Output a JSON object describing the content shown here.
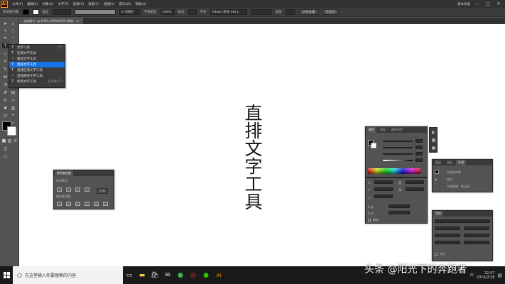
{
  "menubar": {
    "logo": "Ai",
    "items": [
      "文件(F)",
      "编辑(E)",
      "对象(O)",
      "文字(T)",
      "选择(S)",
      "效果(C)",
      "视图(V)",
      "窗口(W)",
      "帮助(H)"
    ],
    "workspace": "基本功能",
    "window_buttons": [
      "—",
      "□",
      "✕"
    ]
  },
  "controlbar": {
    "label_none_selected": "未选择对象",
    "stroke_label": "描边",
    "profile_value": "5 点圆形",
    "opacity_label": "不透明度",
    "opacity_value": "100%",
    "style_label": "样式",
    "char_label": "字符",
    "font_value": "Adobe 宋体 Std L",
    "para_label": "段落",
    "doc_setup": "文档设置",
    "preferences": "首选项",
    "fill_color": "#000000",
    "stroke_color": "#ffffff"
  },
  "tab": {
    "title": "未标题-1* @ 100% (CMYK/GPU 预览)",
    "close": "✕"
  },
  "flyout": {
    "items": [
      {
        "label": "文字工具",
        "key": "(T)",
        "icon": "T"
      },
      {
        "label": "区域文字工具",
        "key": "",
        "icon": "T"
      },
      {
        "label": "路径文字工具",
        "key": "",
        "icon": "~"
      },
      {
        "label": "直排文字工具",
        "key": "",
        "icon": "T"
      },
      {
        "label": "直排区域文字工具",
        "key": "",
        "icon": "T"
      },
      {
        "label": "直排路径文字工具",
        "key": "",
        "icon": "~"
      },
      {
        "label": "修饰文字工具",
        "key": "(Shift+T)",
        "icon": "T"
      }
    ],
    "highlighted_index": 3
  },
  "canvas": {
    "vertical_text": "直排文字工具"
  },
  "pathfinder_panel": {
    "title": "路径查找器",
    "shape_modes": "形状模式：",
    "expand": "扩展",
    "pathfinders": "路径查找器："
  },
  "color_panel": {
    "tabs": [
      "颜色",
      "色板",
      "颜色参考"
    ],
    "fill_color": "#000000",
    "stroke_color": "#ffffff"
  },
  "transform_panel": {
    "fields": [
      "X:",
      "Y:",
      "宽:",
      "高:"
    ],
    "angle_label": "△:",
    "value_a": "0 pt",
    "value_b": "0 pt",
    "align_label": "对齐像素网格",
    "checkbox_label": "缩放"
  },
  "layers_panel": {
    "tabs": [
      "图层",
      "画板",
      "外观"
    ],
    "row1": "未选择对象",
    "row2": "描边：",
    "row3": "不透明度：默认值"
  },
  "char_panel": {
    "title": "字符",
    "font_field": "Adobe 宋体",
    "checkbox_label": "字符"
  },
  "status": {
    "zoom": "100%",
    "tool_name": "直排文字"
  },
  "taskbar": {
    "search_placeholder": "在这里输入你要搜索的内容",
    "time": "22:57",
    "date": "2019/2/16",
    "language": "中"
  },
  "watermark": "头条 @阳光下的奔跑者"
}
